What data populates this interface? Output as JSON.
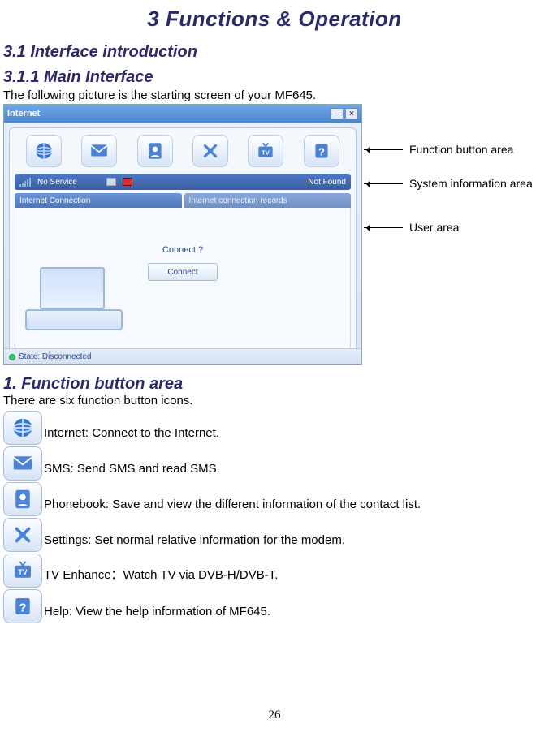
{
  "chapter_title": "3 Functions & Operation",
  "section_title": "3.1 Interface introduction",
  "subsection_title": "3.1.1 Main Interface",
  "intro_text": "The following picture is the starting screen of your MF645.",
  "screenshot": {
    "title": "Internet",
    "sys_no_service": "No Service",
    "sys_not_found": "Not Found",
    "tab_left": "Internet Connection",
    "tab_right": "Internet connection records",
    "connect_prompt": "Connect ?",
    "connect_button": "Connect",
    "status_label": "State: Disconnected"
  },
  "labels": {
    "func_area": "Function button area",
    "sys_area": "System information area",
    "user_area": "User area"
  },
  "func_heading": "1. Function button area",
  "func_intro": "There are six function button icons.",
  "functions": [
    {
      "name": "internet-icon",
      "text": "Internet: Connect to the Internet."
    },
    {
      "name": "sms-icon",
      "text": "SMS: Send SMS and read SMS."
    },
    {
      "name": "phonebook-icon",
      "text": "Phonebook: Save and view the different information of the contact list."
    },
    {
      "name": "settings-icon",
      "text": "Settings: Set normal relative information for the modem."
    },
    {
      "name": "tv-icon",
      "text": "TV Enhance：Watch TV via DVB-H/DVB-T."
    },
    {
      "name": "help-icon",
      "text": "Help: View the help information of MF645."
    }
  ],
  "page_number": "26"
}
